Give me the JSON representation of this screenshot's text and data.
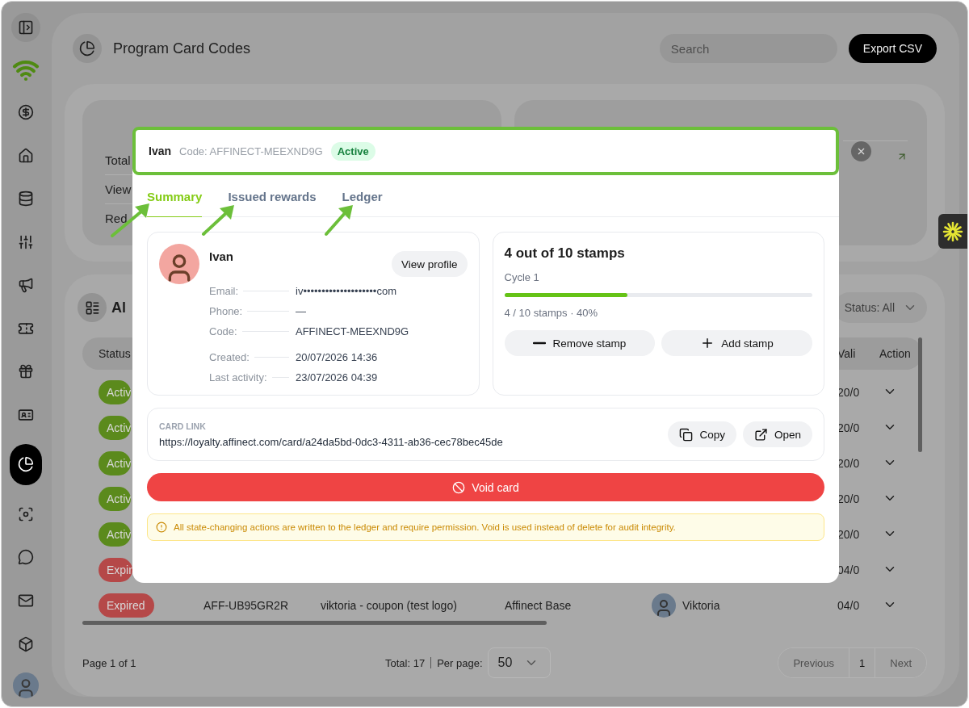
{
  "sidebar": {
    "items": [
      {
        "kind": "money",
        "selected": false
      },
      {
        "kind": "home",
        "selected": false
      },
      {
        "kind": "database",
        "selected": false
      },
      {
        "kind": "sliders",
        "selected": false
      },
      {
        "kind": "megaphone",
        "selected": false
      },
      {
        "kind": "ticket",
        "selected": false
      },
      {
        "kind": "gift",
        "selected": false
      },
      {
        "kind": "id-card",
        "selected": false
      },
      {
        "kind": "pie-chart",
        "selected": true
      },
      {
        "kind": "scan",
        "selected": false
      },
      {
        "kind": "chat",
        "selected": false
      },
      {
        "kind": "mail",
        "selected": false
      },
      {
        "kind": "box",
        "selected": false
      }
    ]
  },
  "header": {
    "title": "Program Card Codes",
    "search": {
      "placeholder": "Search"
    },
    "export_button": "Export CSV"
  },
  "stats": {
    "rows": [
      "Total",
      "View",
      "Red"
    ]
  },
  "table": {
    "title": "Al",
    "status_filter": "Status: All",
    "columns": [
      "Status",
      "Vali",
      "Action"
    ],
    "rows": [
      {
        "status": "Activ",
        "kind": "active",
        "valid": "20/0"
      },
      {
        "status": "Activ",
        "kind": "active",
        "valid": "20/0"
      },
      {
        "status": "Activ",
        "kind": "active",
        "valid": "20/0"
      },
      {
        "status": "Activ",
        "kind": "active",
        "valid": "20/0"
      },
      {
        "status": "Activ",
        "kind": "active",
        "valid": "20/0"
      },
      {
        "status": "Expir",
        "kind": "expired",
        "valid": "04/0"
      },
      {
        "status": "Expired",
        "kind": "expired",
        "code": "AFF-UB95GR2R",
        "name": "viktoria - coupon (test logo)",
        "program": "Affinect Base",
        "owner": "Viktoria",
        "valid": "04/0"
      }
    ]
  },
  "footer": {
    "page": "Page 1 of 1",
    "total": "Total: 17",
    "per_page_label": "Per page:",
    "per_page": "50",
    "previous": {
      "label": "Previous",
      "disabled": true
    },
    "current": "1",
    "next": {
      "label": "Next",
      "disabled": true
    }
  },
  "modal": {
    "name": "Ivan",
    "code": "Code: AFFINECT-MEEXND9G",
    "status": {
      "label": "Active",
      "kind": "active"
    },
    "tabs": [
      {
        "label": "Summary",
        "selected": true
      },
      {
        "label": "Issued rewards",
        "selected": false
      },
      {
        "label": "Ledger",
        "selected": false
      }
    ],
    "profile": {
      "name": "Ivan",
      "view_button": "View profile",
      "field_groups": [
        [
          {
            "label": "Email:",
            "value": "iv••••••••••••••••••••com"
          },
          {
            "label": "Phone:",
            "value": "—"
          },
          {
            "label": "Code:",
            "value": "AFFINECT-MEEXND9G"
          }
        ],
        [
          {
            "label": "Created:",
            "value": "20/07/2026 14:36"
          },
          {
            "label": "Last activity:",
            "value": "23/07/2026 04:39"
          }
        ]
      ]
    },
    "stamps": {
      "title": "4 out of 10 stamps",
      "cycle": "Cycle 1",
      "level": 0.4,
      "reading": "4 / 10 stamps · 40%",
      "buttons": [
        {
          "label": "Remove stamp",
          "kind": "remove"
        },
        {
          "label": "Add stamp",
          "kind": "add"
        }
      ]
    },
    "card_link": {
      "label": "CARD LINK",
      "url": "https://loyalty.affinect.com/card/a24da5bd-0dc3-4311-ab36-cec78bec45de",
      "buttons": [
        {
          "label": "Copy",
          "kind": "copy"
        },
        {
          "label": "Open",
          "kind": "open"
        }
      ]
    },
    "void_button": "Void card",
    "notice": "All state-changing actions are written to the ledger and require permission. Void is used instead of delete for audit integrity."
  }
}
